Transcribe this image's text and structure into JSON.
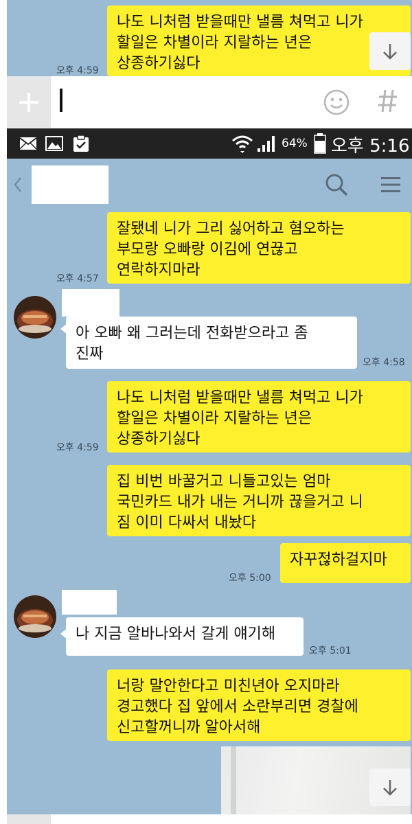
{
  "top_chat": {
    "message": {
      "lines": [
        "나도 니처럼 받을때만 낼름 쳐먹고 니가",
        "할일은 차별이라 지랄하는 년은",
        "상종하기싫다"
      ],
      "time": "오후 4:59"
    }
  },
  "input_bar": {
    "plus_icon": "plus-icon",
    "emoji_icon": "emoji-icon",
    "hash_icon": "hash-icon"
  },
  "status_bar": {
    "battery": "64%",
    "time": "오후 5:16",
    "icons": [
      "mail-icon",
      "image-icon",
      "clipboard-check-icon",
      "wifi-icon",
      "signal-icon",
      "battery-icon"
    ]
  },
  "header": {
    "back_icon": "chevron-left-icon",
    "search_icon": "search-icon",
    "menu_icon": "hamburger-menu-icon"
  },
  "messages": [
    {
      "side": "right",
      "lines": [
        "잘됐네 니가 그리 싫어하고 혐오하는",
        "부모랑 오빠랑 이김에 연끊고",
        "연락하지마라"
      ],
      "time": "오후 4:57"
    },
    {
      "side": "left",
      "lines": [
        "아 오빠 왜 그러는데 전화받으라고 좀",
        "진짜"
      ],
      "time": "오후 4:58"
    },
    {
      "side": "right",
      "lines": [
        "나도 니처럼 받을때만 낼름 쳐먹고 니가",
        "할일은 차별이라 지랄하는 년은",
        "상종하기싫다"
      ],
      "time": "오후 4:59"
    },
    {
      "side": "right",
      "lines": [
        "집 비번 바꿀거고 니들고있는 엄마",
        "국민카드  내가 내는 거니까 끊을거고 니",
        "짐 이미 다싸서 내놨다"
      ],
      "time": ""
    },
    {
      "side": "right",
      "lines": [
        "자꾸젆하걸지마"
      ],
      "time": "오후 5:00"
    },
    {
      "side": "left",
      "lines": [
        "나 지금 알바나와서 갈게 얘기해"
      ],
      "time": "오후 5:01"
    },
    {
      "side": "right",
      "lines": [
        "너랑 말안한다고 미친년아 오지마라",
        "경고했다 집 앞에서 소란부리면 경찰에",
        "신고할꺼니까 알아서해"
      ],
      "time": ""
    }
  ],
  "colors": {
    "chat_bg": "#9bbbd4",
    "my_bubble": "#fff02e",
    "their_bubble": "#ffffff",
    "status_bar": "#222222"
  }
}
